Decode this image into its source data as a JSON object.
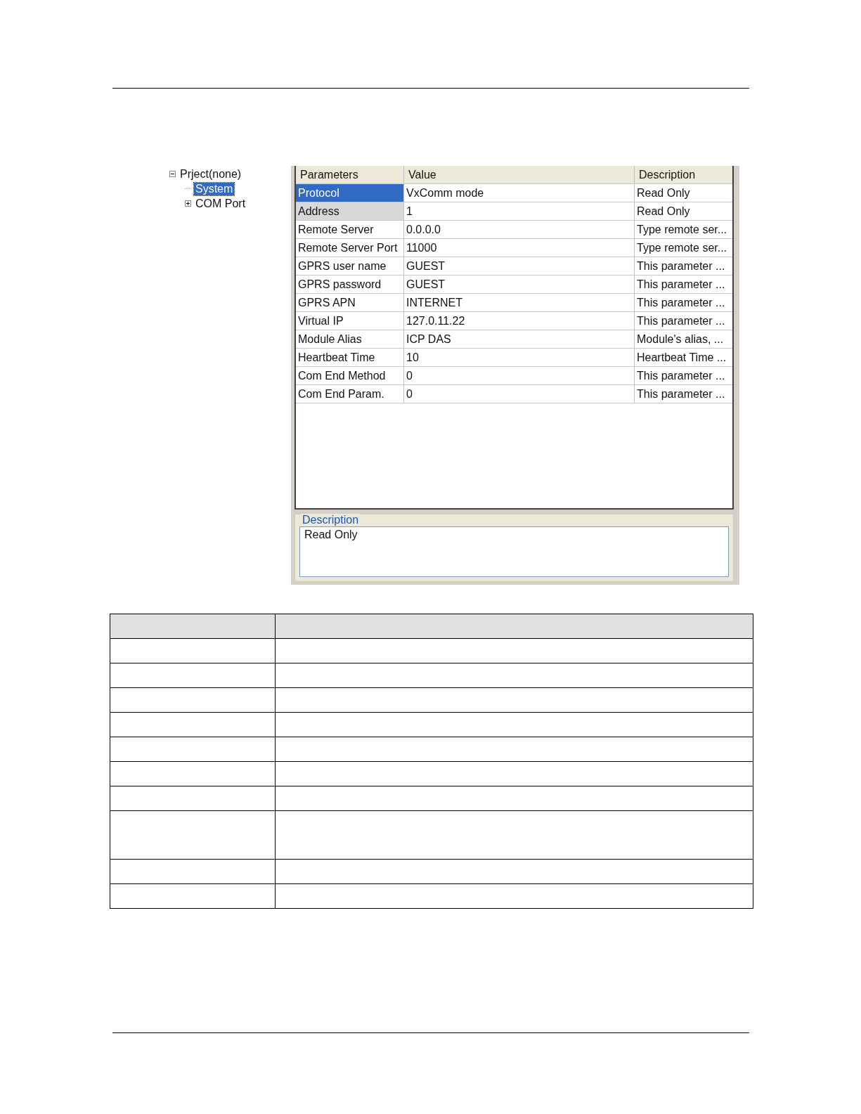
{
  "tree": [
    {
      "label": "Prject(none)",
      "expanded": true,
      "selected": false,
      "children": [
        {
          "label": "System",
          "selected": true
        },
        {
          "label": "COM Port",
          "expanded": false,
          "selected": false
        }
      ]
    }
  ],
  "grid": {
    "columns": [
      "Parameters",
      "Value",
      "Description"
    ],
    "rows": [
      {
        "cells": [
          "Protocol",
          "VxComm mode",
          "Read Only"
        ],
        "selected": true,
        "highlighted": false
      },
      {
        "cells": [
          "Address",
          "1",
          "Read Only"
        ],
        "selected": false,
        "highlighted": true
      },
      {
        "cells": [
          "Remote Server",
          "0.0.0.0",
          "Type remote ser..."
        ],
        "selected": false,
        "highlighted": false
      },
      {
        "cells": [
          "Remote Server Port",
          "11000",
          "Type remote ser..."
        ],
        "selected": false,
        "highlighted": false
      },
      {
        "cells": [
          "GPRS user name",
          "GUEST",
          "This parameter ..."
        ],
        "selected": false,
        "highlighted": false
      },
      {
        "cells": [
          "GPRS password",
          "GUEST",
          "This parameter ..."
        ],
        "selected": false,
        "highlighted": false
      },
      {
        "cells": [
          "GPRS APN",
          "INTERNET",
          "This parameter ..."
        ],
        "selected": false,
        "highlighted": false
      },
      {
        "cells": [
          "Virtual IP",
          "127.0.11.22",
          "This parameter ..."
        ],
        "selected": false,
        "highlighted": false
      },
      {
        "cells": [
          "Module Alias",
          "ICP DAS",
          "Module's alias, ..."
        ],
        "selected": false,
        "highlighted": false
      },
      {
        "cells": [
          "Heartbeat Time",
          "10",
          "Heartbeat Time ..."
        ],
        "selected": false,
        "highlighted": false
      },
      {
        "cells": [
          "Com End Method",
          "0",
          "This parameter ..."
        ],
        "selected": false,
        "highlighted": false
      },
      {
        "cells": [
          "Com End Param.",
          "0",
          "This parameter ..."
        ],
        "selected": false,
        "highlighted": false
      }
    ]
  },
  "description": {
    "title": "Description",
    "value": "Read Only"
  }
}
